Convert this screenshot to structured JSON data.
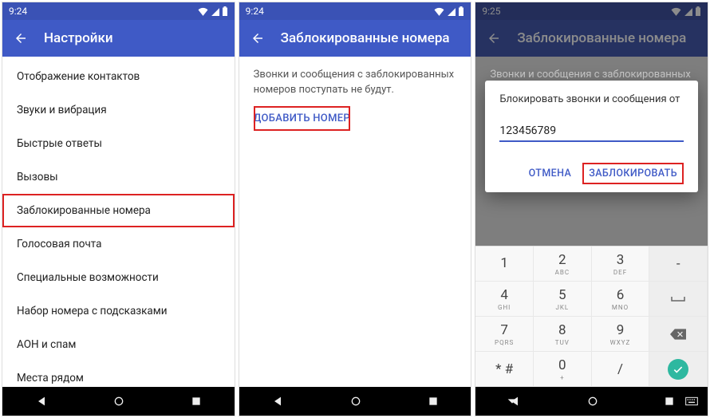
{
  "screen1": {
    "time": "9:24",
    "title": "Настройки",
    "items": [
      "Отображение контактов",
      "Звуки и вибрация",
      "Быстрые ответы",
      "Вызовы",
      "Заблокированные номера",
      "Голосовая почта",
      "Специальные возможности",
      "Набор номера с подсказками",
      "АОН и спам",
      "Места рядом"
    ]
  },
  "screen2": {
    "time": "9:24",
    "title": "Заблокированные номера",
    "desc": "Звонки и сообщения с заблокированных номеров поступать не будут.",
    "add": "ДОБАВИТЬ НОМЕР"
  },
  "screen3": {
    "time": "9:25",
    "title": "Заблокированные номера",
    "desc": "Звонки и сообщения с заблокированных номеров поступать не будут.",
    "dialog": {
      "title": "Блокировать звонки и сообщения от",
      "value": "123456789",
      "cancel": "ОТМЕНА",
      "block": "ЗАБЛОКИРОВАТЬ"
    },
    "keys": {
      "k1d": "1",
      "k1l": "",
      "k2d": "2",
      "k2l": "ABC",
      "k3d": "3",
      "k3l": "DEF",
      "dash": "-",
      "k4d": "4",
      "k4l": "GHI",
      "k5d": "5",
      "k5l": "JKL",
      "k6d": "6",
      "k6l": "MNO",
      "space": "␣",
      "k7d": "7",
      "k7l": "PQRS",
      "k8d": "8",
      "k8l": "TUV",
      "k9d": "9",
      "k9l": "WXYZ",
      "kstar": "* #",
      "kstarl": "",
      "k0d": "0",
      "k0l": "+",
      "slash": "/"
    }
  }
}
